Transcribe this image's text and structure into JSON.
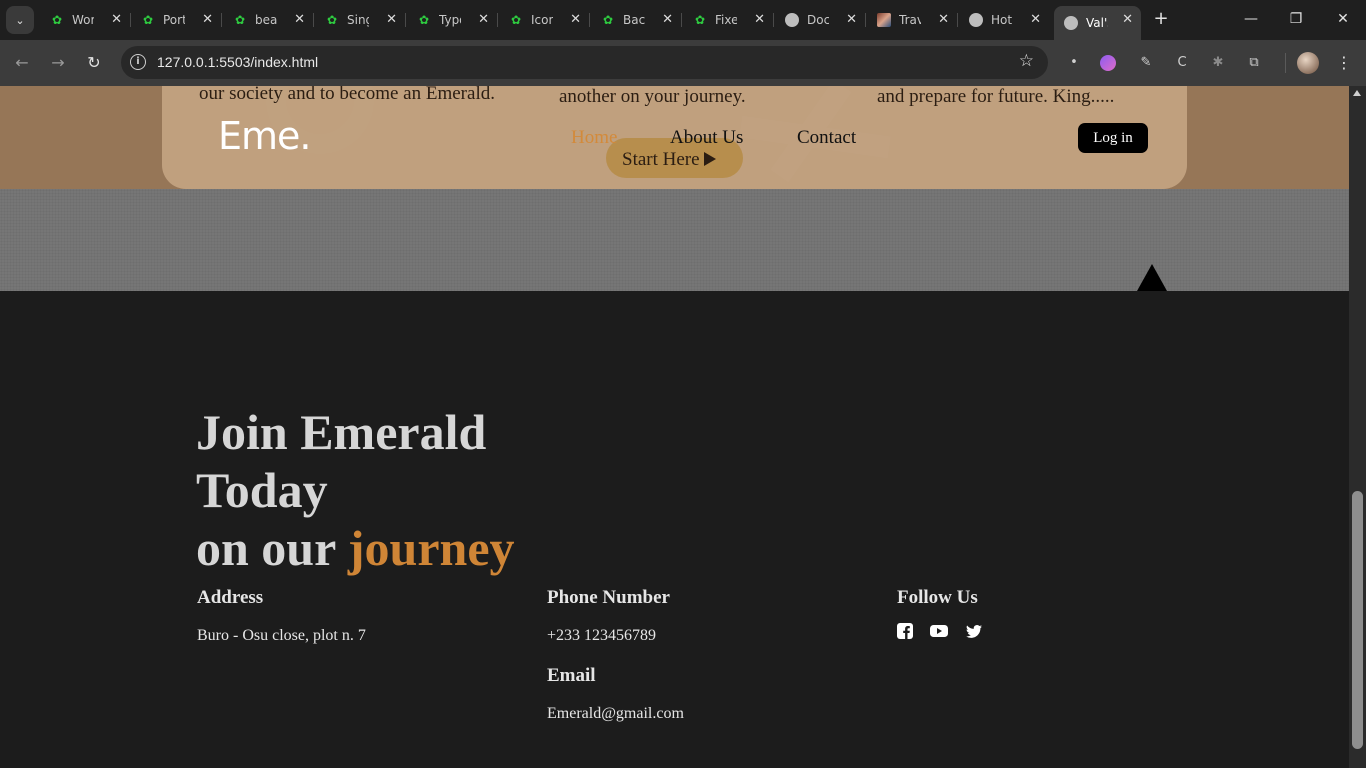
{
  "browser": {
    "tabs": [
      {
        "label": "Wor",
        "favicon": "leaf-icon"
      },
      {
        "label": "Port",
        "favicon": "leaf-icon"
      },
      {
        "label": "beau",
        "favicon": "leaf-icon"
      },
      {
        "label": "Sing",
        "favicon": "leaf-icon"
      },
      {
        "label": "Typo",
        "favicon": "leaf-icon"
      },
      {
        "label": "Icon",
        "favicon": "leaf-icon"
      },
      {
        "label": "Back",
        "favicon": "leaf-icon"
      },
      {
        "label": "Fixe",
        "favicon": "leaf-icon"
      },
      {
        "label": "Doc",
        "favicon": "globe-icon"
      },
      {
        "label": "Trav",
        "favicon": "image-icon"
      },
      {
        "label": "Hot",
        "favicon": "globe-icon"
      },
      {
        "label": "Val's",
        "favicon": "globe-icon",
        "active": true
      }
    ],
    "url": "127.0.0.1:5503/index.html"
  },
  "page": {
    "hero": {
      "text_left": "our society and to become an Emerald.",
      "text_mid": "another on your journey.",
      "text_right": "and prepare for future. King.....",
      "start_label": "Start Here"
    },
    "nav": {
      "logo": "Eme.",
      "links": [
        "Home",
        "About Us",
        "Contact"
      ],
      "login": "Log in"
    },
    "footer": {
      "headline_line1": "Join Emerald",
      "headline_line2": "Today",
      "headline_line3_prefix": "on our",
      "headline_accent": "journey",
      "address_title": "Address",
      "address_value": "Buro - Osu close, plot n. 7",
      "phone_title": "Phone Number",
      "phone_value": "+233 123456789",
      "email_title": "Email",
      "email_value": "Emerald@gmail.com",
      "follow_title": "Follow Us",
      "social_icons": [
        "facebook-icon",
        "youtube-icon",
        "twitter-icon"
      ]
    }
  },
  "colors": {
    "accent": "#cf8536",
    "footer_bg": "#1c1c1c",
    "nav_card": "#c9a987"
  }
}
